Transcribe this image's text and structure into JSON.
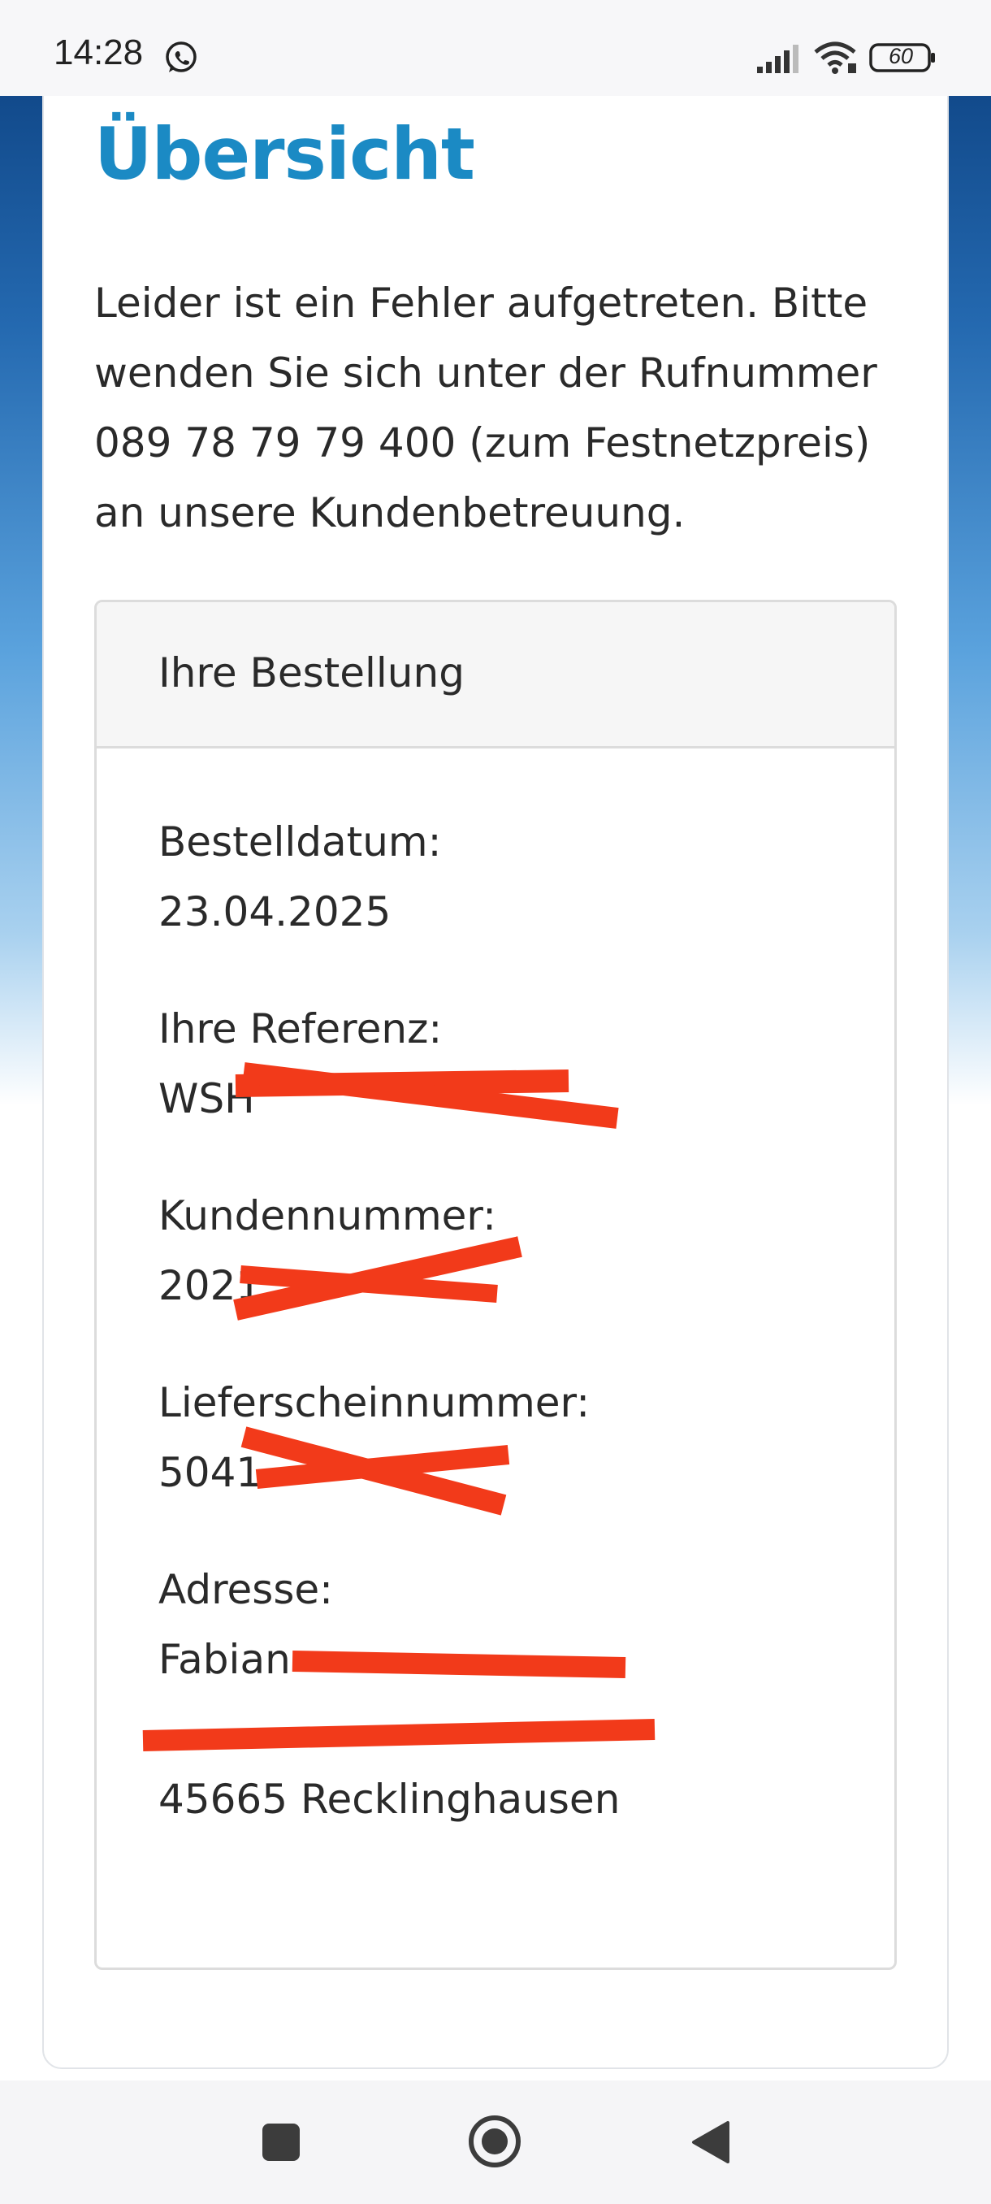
{
  "status_bar": {
    "time": "14:28",
    "battery": "60",
    "icons": [
      "whatsapp-icon",
      "signal-icon",
      "wifi-icon",
      "battery-icon"
    ]
  },
  "page": {
    "title": "Übersicht",
    "error_lines": [
      "Leider ist ein Fehler aufgetreten. Bitte",
      "wenden Sie sich unter der Rufnummer",
      "089 78 79 79 400 (zum Festnetzpreis)",
      "an unsere Kundenbetreuung."
    ]
  },
  "order": {
    "header": "Ihre Bestellung",
    "order_date_label": "Bestelldatum:",
    "order_date": "23.04.2025",
    "reference_label": "Ihre Referenz:",
    "reference_visible": "WSH",
    "customer_number_label": "Kundennummer:",
    "customer_number_visible": "2021",
    "delivery_note_label": "Lieferscheinnummer:",
    "delivery_note_visible": "5041",
    "address_label": "Adresse:",
    "address_name_visible": "Fabian",
    "address_city": "45665 Recklinghausen"
  },
  "colors": {
    "title_blue": "#1b8ac4",
    "redaction_red": "#f23a1a"
  },
  "navigation": [
    "recent-apps-button",
    "home-button",
    "back-button"
  ]
}
